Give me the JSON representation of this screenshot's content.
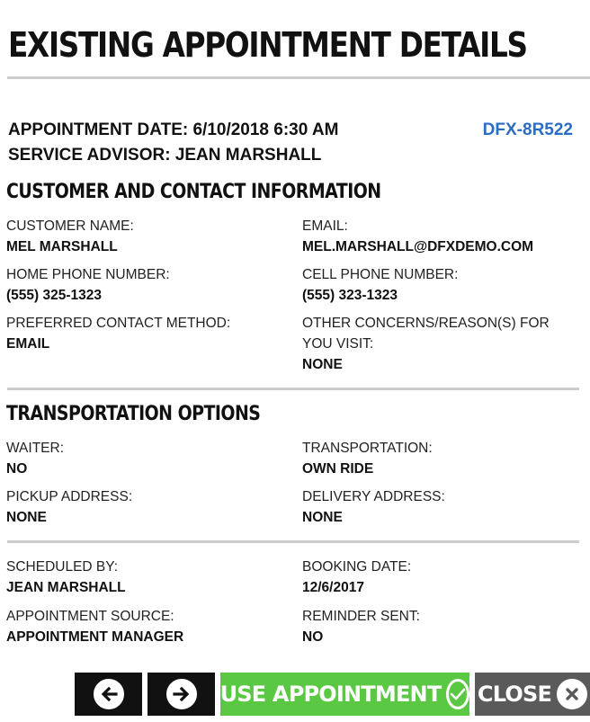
{
  "title": "EXISTING APPOINTMENT DETAILS",
  "appointment": {
    "date_line": "APPOINTMENT DATE: 6/10/2018 6:30 AM",
    "advisor_line": "SERVICE ADVISOR: JEAN MARSHALL",
    "id": "DFX-8R522"
  },
  "customer": {
    "heading": "CUSTOMER AND CONTACT INFORMATION",
    "name_label": "CUSTOMER NAME:",
    "name": "MEL MARSHALL",
    "email_label": "EMAIL:",
    "email": "MEL.MARSHALL@DFXDEMO.COM",
    "home_phone_label": "HOME PHONE NUMBER:",
    "home_phone": "(555) 325-1323",
    "cell_phone_label": "CELL PHONE NUMBER:",
    "cell_phone": "(555) 323-1323",
    "contact_method_label": "PREFERRED CONTACT METHOD:",
    "contact_method": "EMAIL",
    "concerns_label": "OTHER CONCERNS/REASON(S) FOR YOU VISIT:",
    "concerns": "NONE"
  },
  "transportation": {
    "heading": "TRANSPORTATION OPTIONS",
    "waiter_label": "WAITER:",
    "waiter": "NO",
    "transport_label": "TRANSPORTATION:",
    "transport": "OWN RIDE",
    "pickup_label": "PICKUP ADDRESS:",
    "pickup": "NONE",
    "delivery_label": "DELIVERY ADDRESS:",
    "delivery": "NONE"
  },
  "booking": {
    "scheduled_by_label": "SCHEDULED BY:",
    "scheduled_by": "JEAN MARSHALL",
    "booking_date_label": "BOOKING DATE:",
    "booking_date": "12/6/2017",
    "source_label": "APPOINTMENT SOURCE:",
    "source": "APPOINTMENT MANAGER",
    "reminder_label": "REMINDER SENT:",
    "reminder": "NO"
  },
  "buttons": {
    "prev_icon": "arrow-left-icon",
    "next_icon": "arrow-right-icon",
    "use_label": "USE APPOINTMENT",
    "use_icon": "checkmark-icon",
    "close_label": "CLOSE",
    "close_icon": "close-icon"
  },
  "colors": {
    "accent_blue": "#2b6cc4",
    "use_green": "#5ac843",
    "close_gray": "#5a5a5a",
    "nav_black": "#111111",
    "divider": "#cccccc"
  }
}
